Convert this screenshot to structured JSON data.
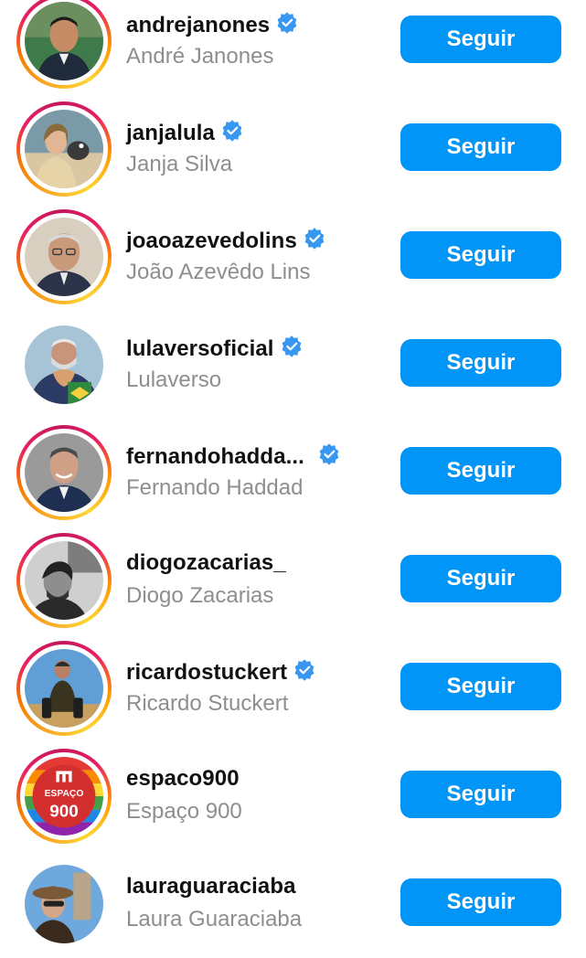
{
  "suggestions": [
    {
      "username": "andrejanones",
      "full_name": "André Janones",
      "verified": true,
      "story_ring": true,
      "button": "Seguir",
      "avatar": "photo-man-suit"
    },
    {
      "username": "janjalula",
      "full_name": "Janja Silva",
      "verified": true,
      "story_ring": true,
      "button": "Seguir",
      "avatar": "photo-woman-dog"
    },
    {
      "username": "joaoazevedolins",
      "full_name": "João Azevêdo Lins",
      "verified": true,
      "story_ring": true,
      "button": "Seguir",
      "avatar": "photo-man-glasses"
    },
    {
      "username": "lulaversoficial",
      "full_name": "Lulaverso",
      "verified": true,
      "story_ring": false,
      "button": "Seguir",
      "avatar": "photo-man-heart-hands"
    },
    {
      "username": "fernandohadda...",
      "full_name": "Fernando Haddad",
      "verified": true,
      "story_ring": true,
      "button": "Seguir",
      "avatar": "photo-man-smiling"
    },
    {
      "username": "diogozacarias_",
      "full_name": "Diogo Zacarias",
      "verified": false,
      "story_ring": true,
      "button": "Seguir",
      "avatar": "photo-man-bw"
    },
    {
      "username": "ricardostuckert",
      "full_name": "Ricardo Stuckert",
      "verified": true,
      "story_ring": true,
      "button": "Seguir",
      "avatar": "photo-photographer"
    },
    {
      "username": "espaco900",
      "full_name": "Espaço 900",
      "verified": false,
      "story_ring": true,
      "button": "Seguir",
      "avatar": "logo-espaco-900",
      "logo_text": [
        "ESPAÇO",
        "900"
      ]
    },
    {
      "username": "lauraguaraciaba",
      "full_name": "Laura Guaraciaba",
      "verified": false,
      "story_ring": false,
      "button": "Seguir",
      "avatar": "photo-woman-hat"
    }
  ],
  "colors": {
    "button": "#0095f6",
    "verified": "#3897f0",
    "secondary_text": "#8e8e8e"
  }
}
